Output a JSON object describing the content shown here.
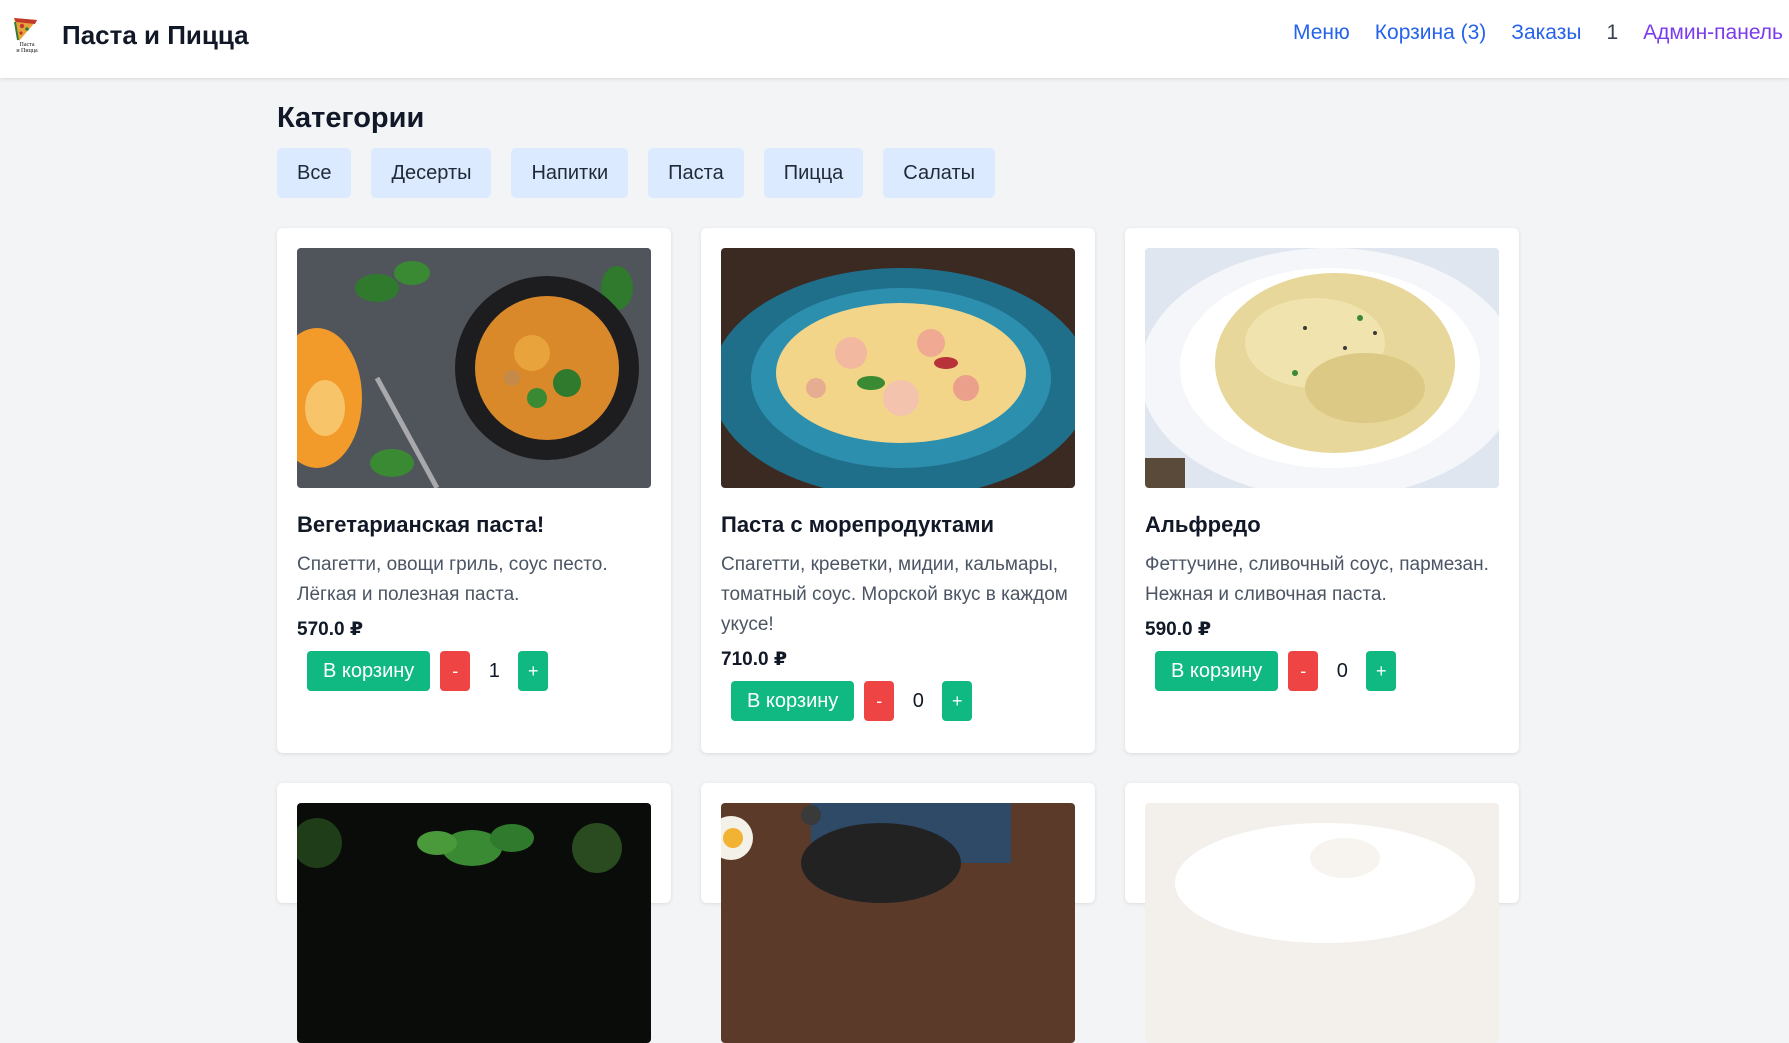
{
  "header": {
    "brand": "Паста и Пицца",
    "logo_text": "Паста и Пицца",
    "nav": {
      "menu": "Меню",
      "cart": "Корзина (3)",
      "orders": "Заказы",
      "count": "1",
      "admin": "Админ-панель"
    }
  },
  "categories": {
    "title": "Категории",
    "items": [
      "Все",
      "Десерты",
      "Напитки",
      "Паста",
      "Пицца",
      "Салаты"
    ]
  },
  "products": [
    {
      "title": "Вегетарианская паста!",
      "description": "Спагетти, овощи гриль, соус песто. Лёгкая и полезная паста.",
      "price": "570.0 ₽",
      "add_label": "В корзину",
      "minus": "-",
      "plus": "+",
      "qty": "1",
      "image": "vegetarian-pasta-photo"
    },
    {
      "title": "Паста с морепродуктами",
      "description": "Спагетти, креветки, мидии, кальмары, томатный соус. Морской вкус в каждом укусе!",
      "price": "710.0 ₽",
      "add_label": "В корзину",
      "minus": "-",
      "plus": "+",
      "qty": "0",
      "image": "seafood-pasta-photo"
    },
    {
      "title": "Альфредо",
      "description": "Феттучине, сливочный соус, пармезан. Нежная и сливочная паста.",
      "price": "590.0 ₽",
      "add_label": "В корзину",
      "minus": "-",
      "plus": "+",
      "qty": "0",
      "image": "alfredo-pasta-photo"
    }
  ],
  "colors": {
    "accent_link": "#2563eb",
    "admin_link": "#7c3aed",
    "cart_button": "#10b981",
    "minus_button": "#ef4444",
    "category_bg": "#dbeafe",
    "page_bg": "#f3f4f6"
  }
}
